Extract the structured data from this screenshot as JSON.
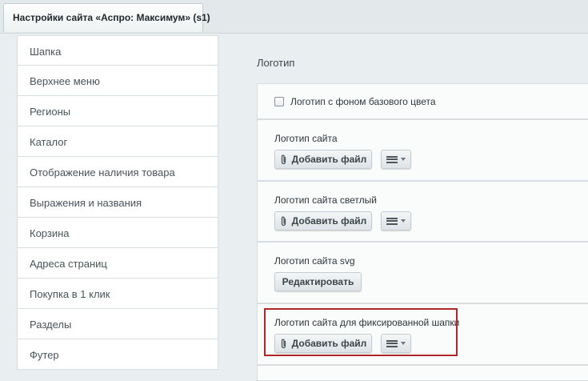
{
  "tab": {
    "title": "Настройки сайта «Аспро: Максимум» (s1)"
  },
  "sidebar": {
    "items": [
      {
        "label": "Шапка"
      },
      {
        "label": "Верхнее меню"
      },
      {
        "label": "Регионы"
      },
      {
        "label": "Каталог"
      },
      {
        "label": "Отображение наличия товара"
      },
      {
        "label": "Выражения и названия"
      },
      {
        "label": "Корзина"
      },
      {
        "label": "Адреса страниц"
      },
      {
        "label": "Покупка в 1 клик"
      },
      {
        "label": "Разделы"
      },
      {
        "label": "Футер"
      }
    ]
  },
  "content": {
    "section_title": "Логотип",
    "checkbox_label": "Логотип с фоном базового цвета",
    "checkbox_checked": false,
    "fields": [
      {
        "label": "Логотип сайта",
        "button": "Добавить файл"
      },
      {
        "label": "Логотип сайта светлый",
        "button": "Добавить файл"
      },
      {
        "label": "Логотип сайта svg",
        "button": "Редактировать"
      },
      {
        "label": "Логотип сайта для фиксированной шапки",
        "button": "Добавить файл"
      }
    ]
  },
  "colors": {
    "highlight": "#b0272a",
    "background": "#e9eef0"
  },
  "icons": {
    "attach": "paperclip-icon",
    "menu": "hamburger-menu-icon"
  }
}
